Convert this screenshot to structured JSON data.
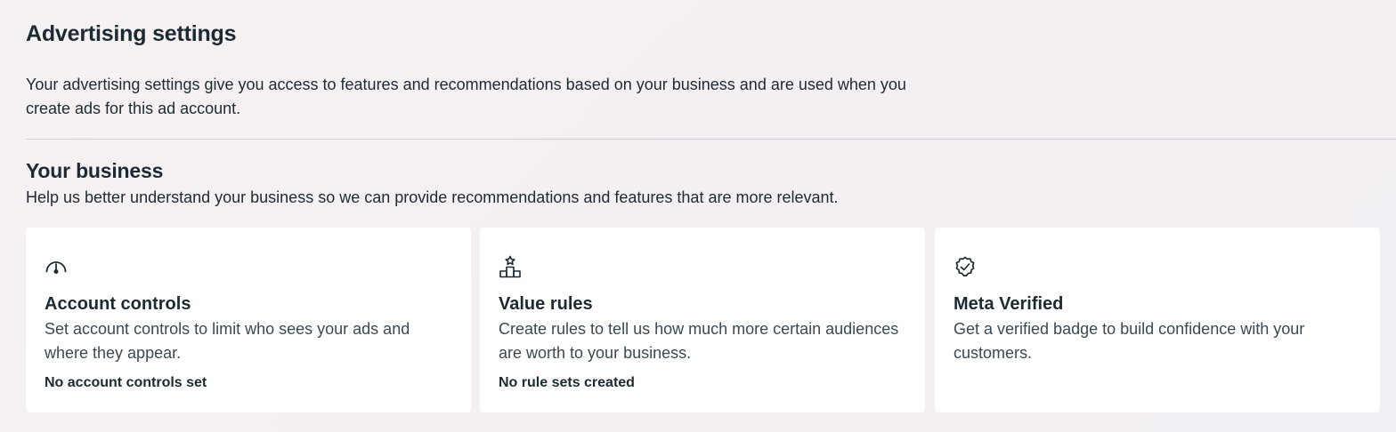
{
  "page": {
    "title": "Advertising settings",
    "description": "Your advertising settings give you access to features and recommendations based on your business and are used when you create ads for this ad account."
  },
  "section": {
    "title": "Your business",
    "description": "Help us better understand your business so we can provide recommendations and features that are more relevant."
  },
  "cards": [
    {
      "icon": "gauge-icon",
      "title": "Account controls",
      "description": "Set account controls to limit who sees your ads and where they appear.",
      "status": "No account controls set"
    },
    {
      "icon": "podium-star-icon",
      "title": "Value rules",
      "description": "Create rules to tell us how much more certain audiences are worth to your business.",
      "status": "No rule sets created"
    },
    {
      "icon": "verified-badge-icon",
      "title": "Meta Verified",
      "description": "Get a verified badge to build confidence with your customers.",
      "status": ""
    }
  ],
  "colors": {
    "text_primary": "#1c2b33",
    "text_secondary": "#3a4a55",
    "card_background": "#ffffff",
    "divider": "#cbd2d9"
  }
}
